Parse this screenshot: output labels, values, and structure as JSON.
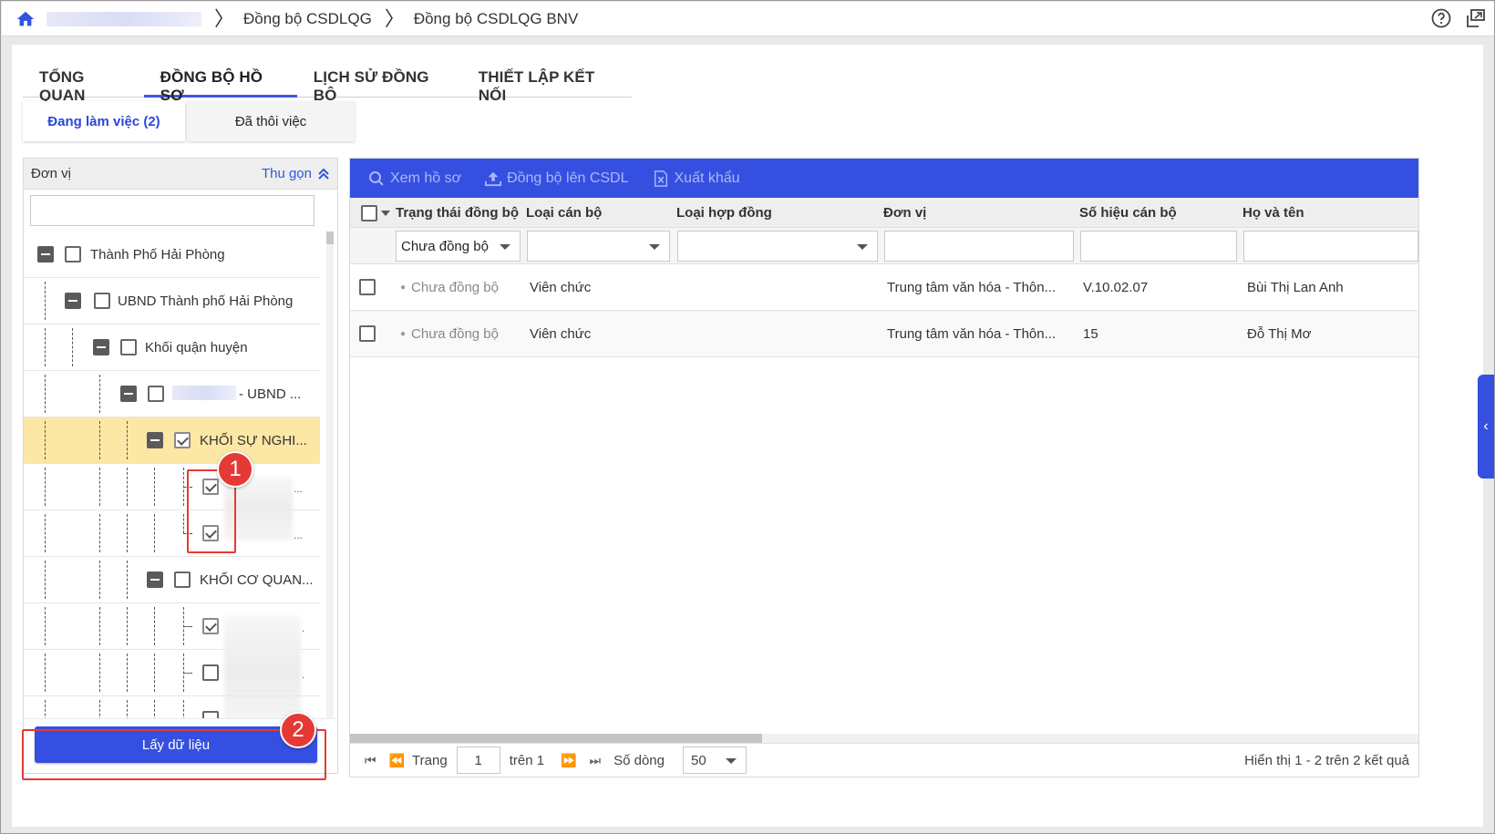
{
  "breadcrumb": {
    "items": [
      "Đồng bộ CSDLQG",
      "Đồng bộ CSDLQG BNV"
    ]
  },
  "icons": {
    "home": "home-icon",
    "help": "help-icon",
    "popout": "popout-icon"
  },
  "tabs": [
    "TỔNG QUAN",
    "ĐỒNG BỘ HỒ SƠ",
    "LỊCH SỬ ĐỒNG BỘ",
    "THIẾT LẬP KẾT NỐI"
  ],
  "active_tab": 1,
  "subtabs": {
    "working": "Đang làm việc (2)",
    "quit": "Đã thôi việc"
  },
  "tree_panel": {
    "title": "Đơn vị",
    "collapse_label": "Thu gọn",
    "search_value": "",
    "nodes": [
      {
        "label": "Thành Phố Hải Phòng",
        "checked": false
      },
      {
        "label": "UBND Thành phố Hải Phòng",
        "checked": false
      },
      {
        "label": "Khối quận huyện",
        "checked": false
      },
      {
        "label": "- UBND ...",
        "checked": false
      },
      {
        "label": "KHỐI SỰ NGHI...",
        "checked": true
      },
      {
        "label": "...",
        "checked": true
      },
      {
        "label": "...",
        "checked": true
      },
      {
        "label": "KHỐI CƠ QUAN...",
        "checked": false
      },
      {
        "label": ".",
        "checked": true
      },
      {
        "label": ".",
        "checked": false
      },
      {
        "label": "",
        "checked": false
      }
    ],
    "fetch_button": "Lấy dữ liệu"
  },
  "annotations": {
    "badge1": "1",
    "badge2": "2"
  },
  "toolbar": {
    "view": "Xem hồ sơ",
    "sync": "Đồng bộ lên CSDL",
    "export": "Xuất khẩu"
  },
  "grid": {
    "columns": [
      "Trạng thái đồng bộ",
      "Loại cán bộ",
      "Loại hợp đồng",
      "Đơn vị",
      "Số hiệu cán bộ",
      "Họ và tên"
    ],
    "filters": {
      "status": "Chưa đồng bộ",
      "staff_type": "",
      "contract_type": "",
      "unit": "",
      "staff_no": "",
      "name": ""
    },
    "rows": [
      {
        "status": "Chưa đồng bộ",
        "staff_type": "Viên chức",
        "contract_type": "",
        "unit": "Trung tâm văn hóa - Thôn...",
        "staff_no": "V.10.02.07",
        "name": "Bùi Thị Lan Anh"
      },
      {
        "status": "Chưa đồng bộ",
        "staff_type": "Viên chức",
        "contract_type": "",
        "unit": "Trung tâm văn hóa - Thôn...",
        "staff_no": "15",
        "name": "Đỗ Thị Mơ"
      }
    ]
  },
  "pager": {
    "page_label": "Trang",
    "page": "1",
    "of_label": "trên 1",
    "rows_label": "Số dòng",
    "rows_per_page": "50",
    "summary": "Hiển thị 1 - 2 trên 2 kết quả"
  },
  "colors": {
    "primary": "#3550e0",
    "selected_row": "#fde7a4",
    "annotation": "#e53935"
  }
}
